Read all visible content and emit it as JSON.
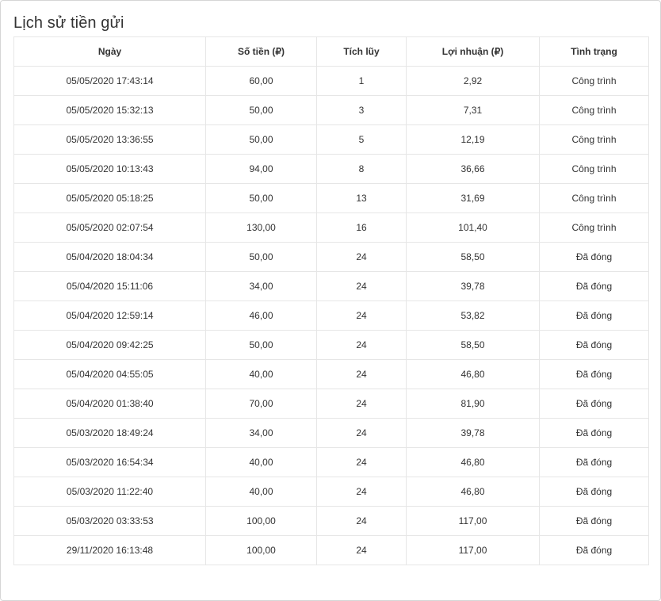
{
  "page": {
    "title": "Lịch sử tiền gửi"
  },
  "table": {
    "headers": [
      "Ngày",
      "Số tiền (₽)",
      "Tích lũy",
      "Lợi nhuận (₽)",
      "Tình trạng"
    ],
    "rows": [
      [
        "05/05/2020 17:43:14",
        "60,00",
        "1",
        "2,92",
        "Công trình"
      ],
      [
        "05/05/2020 15:32:13",
        "50,00",
        "3",
        "7,31",
        "Công trình"
      ],
      [
        "05/05/2020 13:36:55",
        "50,00",
        "5",
        "12,19",
        "Công trình"
      ],
      [
        "05/05/2020 10:13:43",
        "94,00",
        "8",
        "36,66",
        "Công trình"
      ],
      [
        "05/05/2020 05:18:25",
        "50,00",
        "13",
        "31,69",
        "Công trình"
      ],
      [
        "05/05/2020 02:07:54",
        "130,00",
        "16",
        "101,40",
        "Công trình"
      ],
      [
        "05/04/2020 18:04:34",
        "50,00",
        "24",
        "58,50",
        "Đã đóng"
      ],
      [
        "05/04/2020 15:11:06",
        "34,00",
        "24",
        "39,78",
        "Đã đóng"
      ],
      [
        "05/04/2020 12:59:14",
        "46,00",
        "24",
        "53,82",
        "Đã đóng"
      ],
      [
        "05/04/2020 09:42:25",
        "50,00",
        "24",
        "58,50",
        "Đã đóng"
      ],
      [
        "05/04/2020 04:55:05",
        "40,00",
        "24",
        "46,80",
        "Đã đóng"
      ],
      [
        "05/04/2020 01:38:40",
        "70,00",
        "24",
        "81,90",
        "Đã đóng"
      ],
      [
        "05/03/2020 18:49:24",
        "34,00",
        "24",
        "39,78",
        "Đã đóng"
      ],
      [
        "05/03/2020 16:54:34",
        "40,00",
        "24",
        "46,80",
        "Đã đóng"
      ],
      [
        "05/03/2020 11:22:40",
        "40,00",
        "24",
        "46,80",
        "Đã đóng"
      ],
      [
        "05/03/2020 03:33:53",
        "100,00",
        "24",
        "117,00",
        "Đã đóng"
      ],
      [
        "29/11/2020 16:13:48",
        "100,00",
        "24",
        "117,00",
        "Đã đóng"
      ]
    ]
  }
}
